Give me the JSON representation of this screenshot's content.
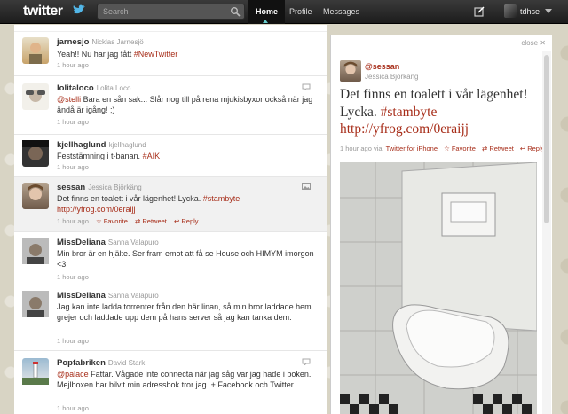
{
  "app": {
    "logo_text": "twitter"
  },
  "search": {
    "placeholder": "Search"
  },
  "nav": {
    "home": "Home",
    "profile": "Profile",
    "messages": "Messages"
  },
  "user": {
    "username": "tdhse"
  },
  "colors": {
    "link": "#a72d19",
    "topbar": "#222222",
    "background": "#d8d4c4"
  },
  "tweets": [
    {
      "screen": "jarnesjo",
      "name": "Nicklas Jarnesjö",
      "text_pre": "Yeah!! Nu har jag fått ",
      "link": "#NewTwitter",
      "text_post": "",
      "time": "1 hour ago"
    },
    {
      "screen": "lolitaloco",
      "name": "Lolita Loco",
      "mention": "@stelli",
      "text_post": " Bara en sån sak... Slår nog till på rena mjukisbyxor också när jag ändå är igång! ;)",
      "time": "1 hour ago"
    },
    {
      "screen": "kjellhaglund",
      "name": "kjellhaglund",
      "text_pre": "Feststämning i t-banan. ",
      "link": "#AIK",
      "time": "1 hour ago"
    },
    {
      "screen": "sessan",
      "name": "Jessica Björkäng",
      "text_pre": "Det finns en toalett i vår lägenhet! Lycka. ",
      "link": "#stambyte",
      "url": "http://yfrog.com/0eraijj",
      "time": "1 hour ago",
      "favorite": "Favorite",
      "retweet": "Retweet",
      "reply": "Reply"
    },
    {
      "screen": "MissDeliana",
      "name": "Sanna Valapuro",
      "text": "Min bror är en hjälte. Ser fram emot att få se House och HIMYM imorgon <3",
      "time": "1 hour ago"
    },
    {
      "screen": "MissDeliana",
      "name": "Sanna Valapuro",
      "text": "Jag kan inte ladda torrenter från den här linan, så min bror laddade hem grejer och laddade upp dem på hans server så jag kan tanka dem.",
      "time": "1 hour ago"
    },
    {
      "screen": "Popfabriken",
      "name": "David Stark",
      "mention": "@palace",
      "text_post": " Fattar. Vågade inte connecta när jag såg var jag hade i boken. Mejlboxen har bilvit min adressbok tror jag. + Facebook och Twitter.",
      "time": "1 hour ago"
    }
  ],
  "detail": {
    "close": "close",
    "close_x": "✕",
    "screen": "@sessan",
    "name": "Jessica Björkäng",
    "text_pre": "Det finns en toalett i vår lägenhet! Lycka. ",
    "hashtag": "#stambyte",
    "url": "http://yfrog.com/0eraijj",
    "time": "1 hour ago via",
    "source": "Twitter for iPhone",
    "favorite": "Favorite",
    "retweet": "Retweet",
    "reply": "Reply"
  }
}
